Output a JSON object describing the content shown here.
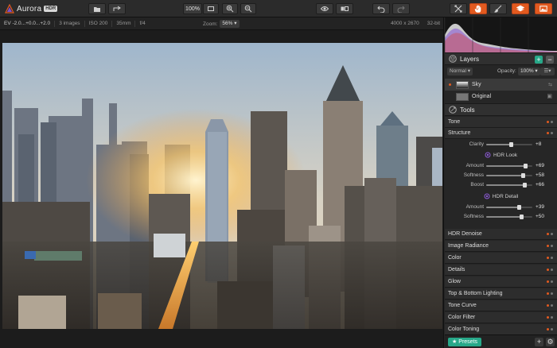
{
  "app": {
    "name": "Aurora",
    "badge": "HDR"
  },
  "toolbar": {
    "zoom_value": "100%",
    "icons": [
      "open-icon",
      "share-icon",
      "fit-icon",
      "zoom-in-icon",
      "zoom-out-icon",
      "preview-eye-icon",
      "compare-icon",
      "undo-icon",
      "redo-icon",
      "crop-icon",
      "hand-icon",
      "brush-icon",
      "layers-stack-icon",
      "image-icon"
    ],
    "active_color": "#e25a1f"
  },
  "info": {
    "ev": "EV -2.0...+0.0...+2.0",
    "images": "3 images",
    "iso": "ISO 200",
    "focal": "35mm",
    "aperture": "f/4",
    "zoom_label": "Zoom:",
    "zoom_value": "56%",
    "dimensions": "4000 x 2670",
    "bitdepth": "32-bit"
  },
  "layers": {
    "title": "Layers",
    "add": "+",
    "remove": "−",
    "blend_mode": "Normal",
    "opacity_label": "Opacity:",
    "opacity_value": "100%",
    "items": [
      {
        "name": "Sky",
        "selected": true
      },
      {
        "name": "Original",
        "selected": false
      }
    ]
  },
  "tools": {
    "title": "Tools",
    "tone": "Tone",
    "structure": "Structure",
    "clarity": {
      "label": "Clarity",
      "value": "+8",
      "fraction": 0.54
    },
    "hdr_look": {
      "title": "HDR Look",
      "sliders": [
        {
          "label": "Amount",
          "value": "+69",
          "fraction": 0.85
        },
        {
          "label": "Softness",
          "value": "+58",
          "fraction": 0.79
        },
        {
          "label": "Boost",
          "value": "+66",
          "fraction": 0.83
        }
      ]
    },
    "hdr_detail": {
      "title": "HDR Detail",
      "sliders": [
        {
          "label": "Amount",
          "value": "+39",
          "fraction": 0.7
        },
        {
          "label": "Softness",
          "value": "+50",
          "fraction": 0.75
        }
      ]
    },
    "modules": [
      "HDR Denoise",
      "Image Radiance",
      "Color",
      "Details",
      "Glow",
      "Top & Bottom Lighting",
      "Tone Curve",
      "Color Filter",
      "Color Toning"
    ]
  },
  "presets": {
    "label": "Presets"
  },
  "colors": {
    "accent_green": "#27a889",
    "accent_orange": "#e25a1f"
  }
}
